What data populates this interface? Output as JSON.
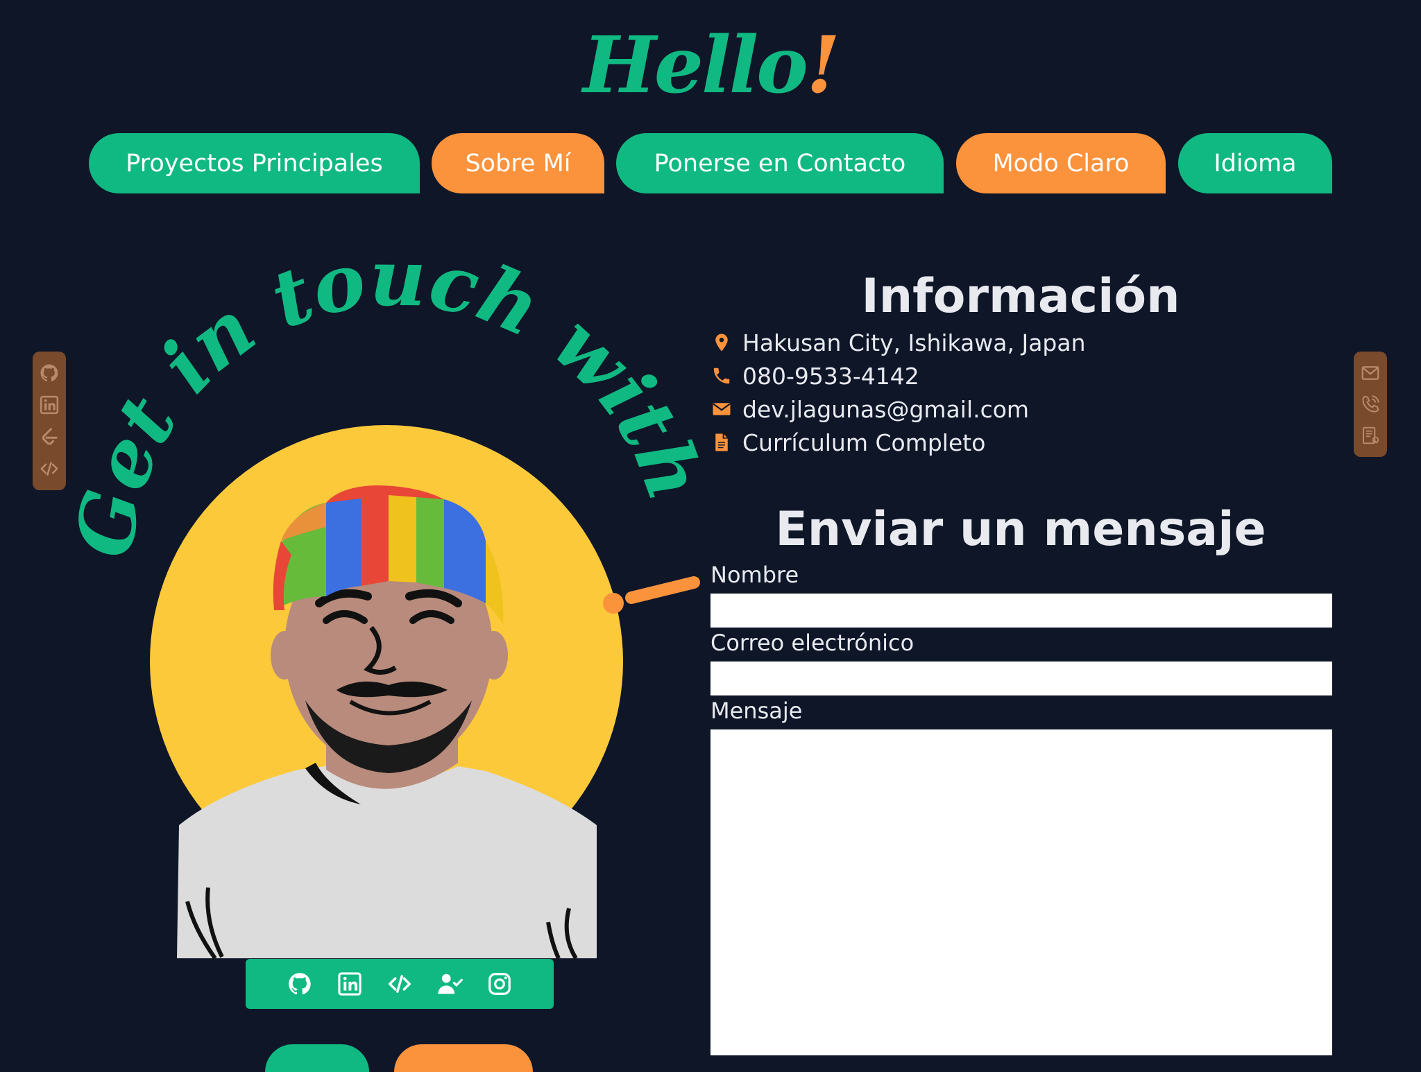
{
  "header": {
    "logo_text": "Hello",
    "logo_bang": "!"
  },
  "nav": {
    "items": [
      {
        "label": "Proyectos Principales",
        "color": "#10b981"
      },
      {
        "label": "Sobre Mí",
        "color": "#fb923c"
      },
      {
        "label": "Ponerse en Contacto",
        "color": "#10b981"
      },
      {
        "label": "Modo Claro",
        "color": "#fb923c"
      },
      {
        "label": "Idioma",
        "color": "#10b981"
      }
    ]
  },
  "left_sidebar": {
    "icons": [
      "github-icon",
      "linkedin-icon",
      "leetcode-icon",
      "code-icon"
    ]
  },
  "right_sidebar": {
    "icons": [
      "mail-icon",
      "phone-icon",
      "resume-icon"
    ]
  },
  "portrait": {
    "arc_text": "Get in touch with me",
    "arc_bang": "!",
    "social_icons": [
      "github-icon",
      "linkedin-icon",
      "code-icon",
      "user-check-icon",
      "instagram-icon"
    ]
  },
  "info": {
    "title": "Información",
    "location": "Hakusan City, Ishikawa, Japan",
    "phone": "080-9533-4142",
    "email": "dev.jlagunas@gmail.com",
    "resume": "Currículum Completo"
  },
  "form": {
    "title": "Enviar un mensaje",
    "name_label": "Nombre",
    "email_label": "Correo electrónico",
    "message_label": "Mensaje",
    "name_value": "",
    "email_value": "",
    "message_value": ""
  },
  "colors": {
    "accent_green": "#10b981",
    "accent_orange": "#fb923c",
    "background": "#0e1628",
    "sun_yellow": "#fcc93b"
  }
}
